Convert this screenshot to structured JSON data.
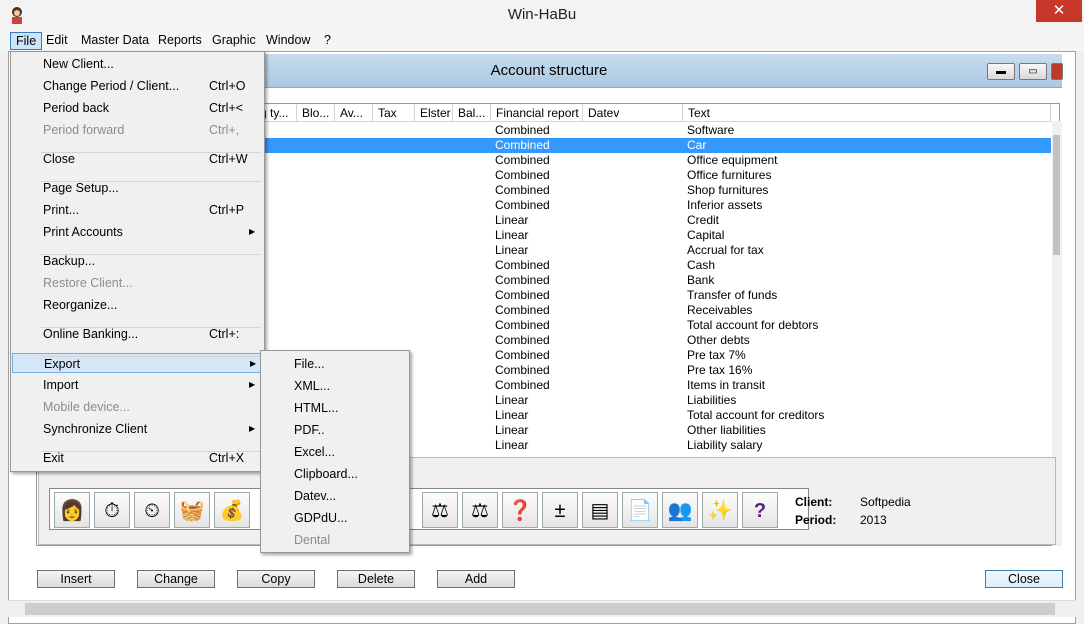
{
  "app": {
    "title": "Win-HaBu",
    "close_glyph": "✕"
  },
  "menubar": [
    "File",
    "Edit",
    "Master Data",
    "Reports",
    "Graphic",
    "Window",
    "?"
  ],
  "window": {
    "title": "Account structure"
  },
  "columns": [
    "g ty...",
    "Blo...",
    "Av...",
    "Tax",
    "Elster",
    "Bal...",
    "Financial report",
    "Datev",
    "Text"
  ],
  "rows": [
    {
      "report": "Combined",
      "text": "Software"
    },
    {
      "report": "Combined",
      "text": "Car",
      "selected": true
    },
    {
      "report": "Combined",
      "text": "Office equipment"
    },
    {
      "report": "Combined",
      "text": "Office furnitures"
    },
    {
      "report": "Combined",
      "text": "Shop furnitures"
    },
    {
      "report": "Combined",
      "text": "Inferior assets"
    },
    {
      "report": "Linear",
      "text": "Credit"
    },
    {
      "report": "Linear",
      "text": "Capital"
    },
    {
      "report": "Linear",
      "text": "Accrual for tax"
    },
    {
      "report": "Combined",
      "text": "Cash"
    },
    {
      "report": "Combined",
      "text": "Bank"
    },
    {
      "report": "Combined",
      "text": "Transfer of funds"
    },
    {
      "report": "Combined",
      "text": "Receivables"
    },
    {
      "report": "Combined",
      "text": "Total account for debtors"
    },
    {
      "report": "Combined",
      "text": "Other debts"
    },
    {
      "report": "Combined",
      "text": "Pre tax 7%"
    },
    {
      "report": "Combined",
      "text": "Pre tax 16%"
    },
    {
      "report": "Combined",
      "text": "Items in transit"
    },
    {
      "report": "Linear",
      "text": "Liabilities"
    },
    {
      "report": "Linear",
      "text": "Total account for creditors"
    },
    {
      "report": "Linear",
      "text": "Other liabilities"
    },
    {
      "report": "Linear",
      "text": "Liability salary"
    }
  ],
  "client_info": {
    "client_label": "Client:",
    "client_value": "Softpedia",
    "period_label": "Period:",
    "period_value": "2013"
  },
  "buttons": {
    "insert": "Insert",
    "change": "Change",
    "copy": "Copy",
    "delete": "Delete",
    "add": "Add",
    "close": "Close"
  },
  "file_menu": [
    {
      "label": "New Client...",
      "shortcut": ""
    },
    {
      "label": "Change Period / Client...",
      "shortcut": "Ctrl+O"
    },
    {
      "label": "Period back",
      "shortcut": "Ctrl+<"
    },
    {
      "label": "Period forward",
      "shortcut": "Ctrl+,",
      "disabled": true
    },
    {
      "label": "Close",
      "shortcut": "Ctrl+W"
    },
    {
      "label": "Page Setup...",
      "shortcut": ""
    },
    {
      "label": "Print...",
      "shortcut": "Ctrl+P"
    },
    {
      "label": "Print Accounts",
      "shortcut": "",
      "submenu": true
    },
    {
      "label": "Backup...",
      "shortcut": ""
    },
    {
      "label": "Restore Client...",
      "shortcut": "",
      "disabled": true
    },
    {
      "label": "Reorganize...",
      "shortcut": ""
    },
    {
      "label": "Online Banking...",
      "shortcut": "Ctrl+:"
    },
    {
      "label": "Export",
      "shortcut": "",
      "submenu": true,
      "highlighted": true
    },
    {
      "label": "Import",
      "shortcut": "",
      "submenu": true
    },
    {
      "label": "Mobile device...",
      "shortcut": "",
      "disabled": true
    },
    {
      "label": "Synchronize Client",
      "shortcut": "",
      "submenu": true
    },
    {
      "label": "Exit",
      "shortcut": "Ctrl+X"
    }
  ],
  "export_menu": [
    {
      "label": "File..."
    },
    {
      "label": "XML..."
    },
    {
      "label": "HTML..."
    },
    {
      "label": "PDF.."
    },
    {
      "label": "Excel..."
    },
    {
      "label": "Clipboard..."
    },
    {
      "label": "Datev..."
    },
    {
      "label": "GDPdU..."
    },
    {
      "label": "Dental",
      "disabled": true
    }
  ],
  "colors": {
    "selection": "#3399ff",
    "menu_highlight": "#d5e6f7",
    "close_red": "#c7372c"
  }
}
